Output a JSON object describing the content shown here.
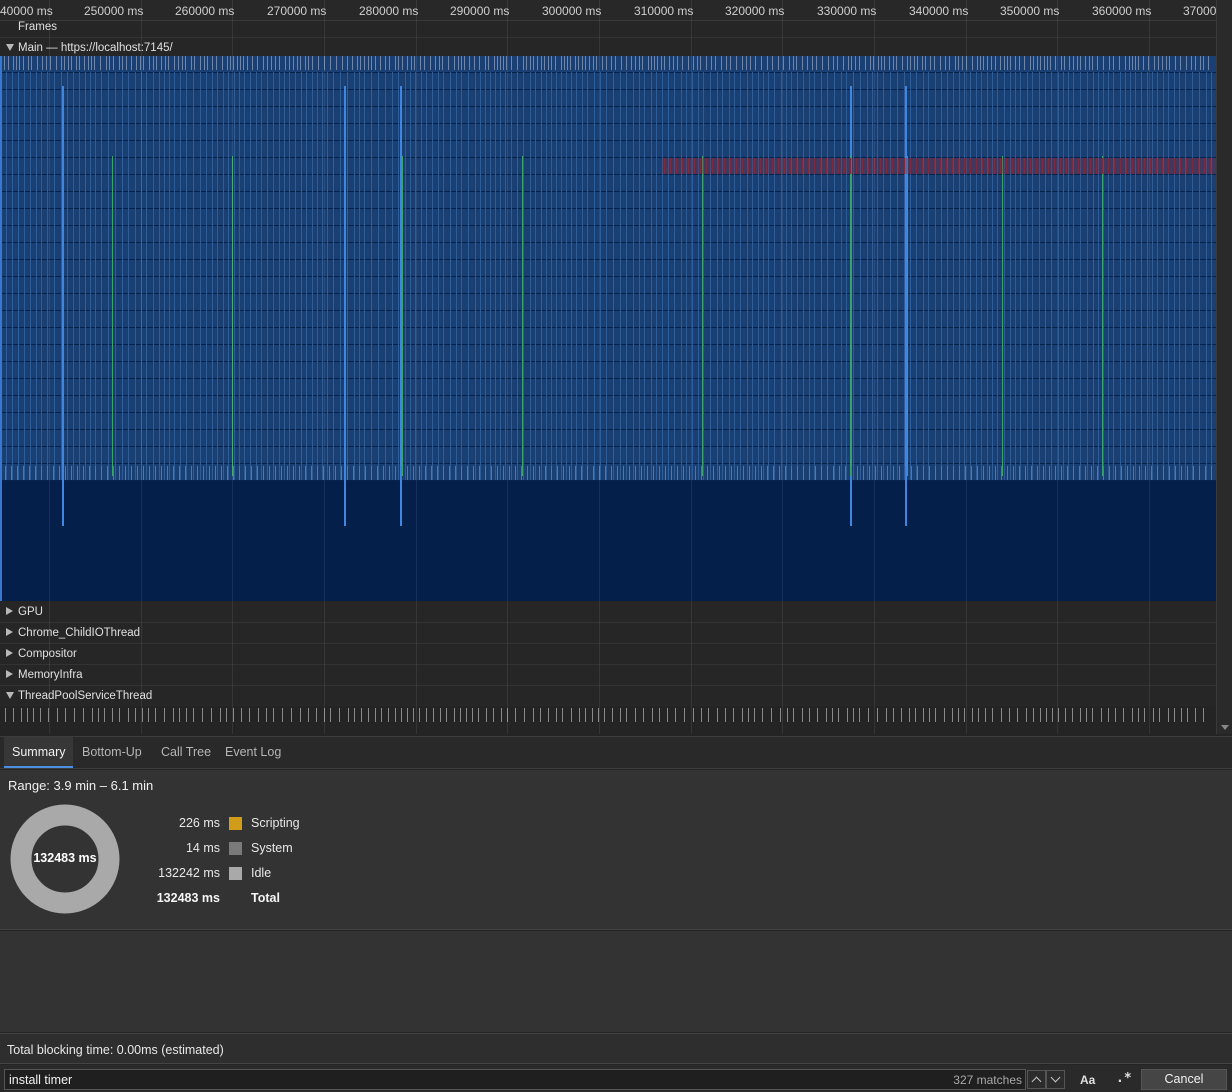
{
  "ruler": {
    "ticks": [
      "40000 ms",
      "250000 ms",
      "260000 ms",
      "270000 ms",
      "280000 ms",
      "290000 ms",
      "300000 ms",
      "310000 ms",
      "320000 ms",
      "330000 ms",
      "340000 ms",
      "350000 ms",
      "360000 ms",
      "37000"
    ]
  },
  "tracks": {
    "frames": "Frames",
    "main": "Main — https://localhost:7145/",
    "gpu": "GPU",
    "child_io": "Chrome_ChildIOThread",
    "compositor": "Compositor",
    "memory_infra": "MemoryInfra",
    "thread_pool": "ThreadPoolServiceThread"
  },
  "tabs": {
    "summary": "Summary",
    "bottom_up": "Bottom-Up",
    "call_tree": "Call Tree",
    "event_log": "Event Log"
  },
  "summary": {
    "range": "Range: 3.9 min – 6.1 min",
    "donut_total": "132483 ms",
    "rows": [
      {
        "value": "226 ms",
        "category": "Scripting",
        "color": "#d19c19"
      },
      {
        "value": "14 ms",
        "category": "System",
        "color": "#7a7a7a"
      },
      {
        "value": "132242 ms",
        "category": "Idle",
        "color": "#a9a9a9"
      }
    ],
    "total": {
      "value": "132483 ms",
      "label": "Total"
    }
  },
  "status": {
    "total_blocking_time": "Total blocking time: 0.00ms (estimated)"
  },
  "search": {
    "query": "install timer",
    "matches": "327 matches",
    "match_case_label": "Aa",
    "regex_label": ".*",
    "cancel_label": "Cancel"
  },
  "colors": {
    "flame_bg": "#06214a",
    "flame_bar": "#1a3f73",
    "highlight_blue": "#3f86e0",
    "highlight_green": "#3aa46b",
    "highlight_red": "#8a2a3a"
  }
}
